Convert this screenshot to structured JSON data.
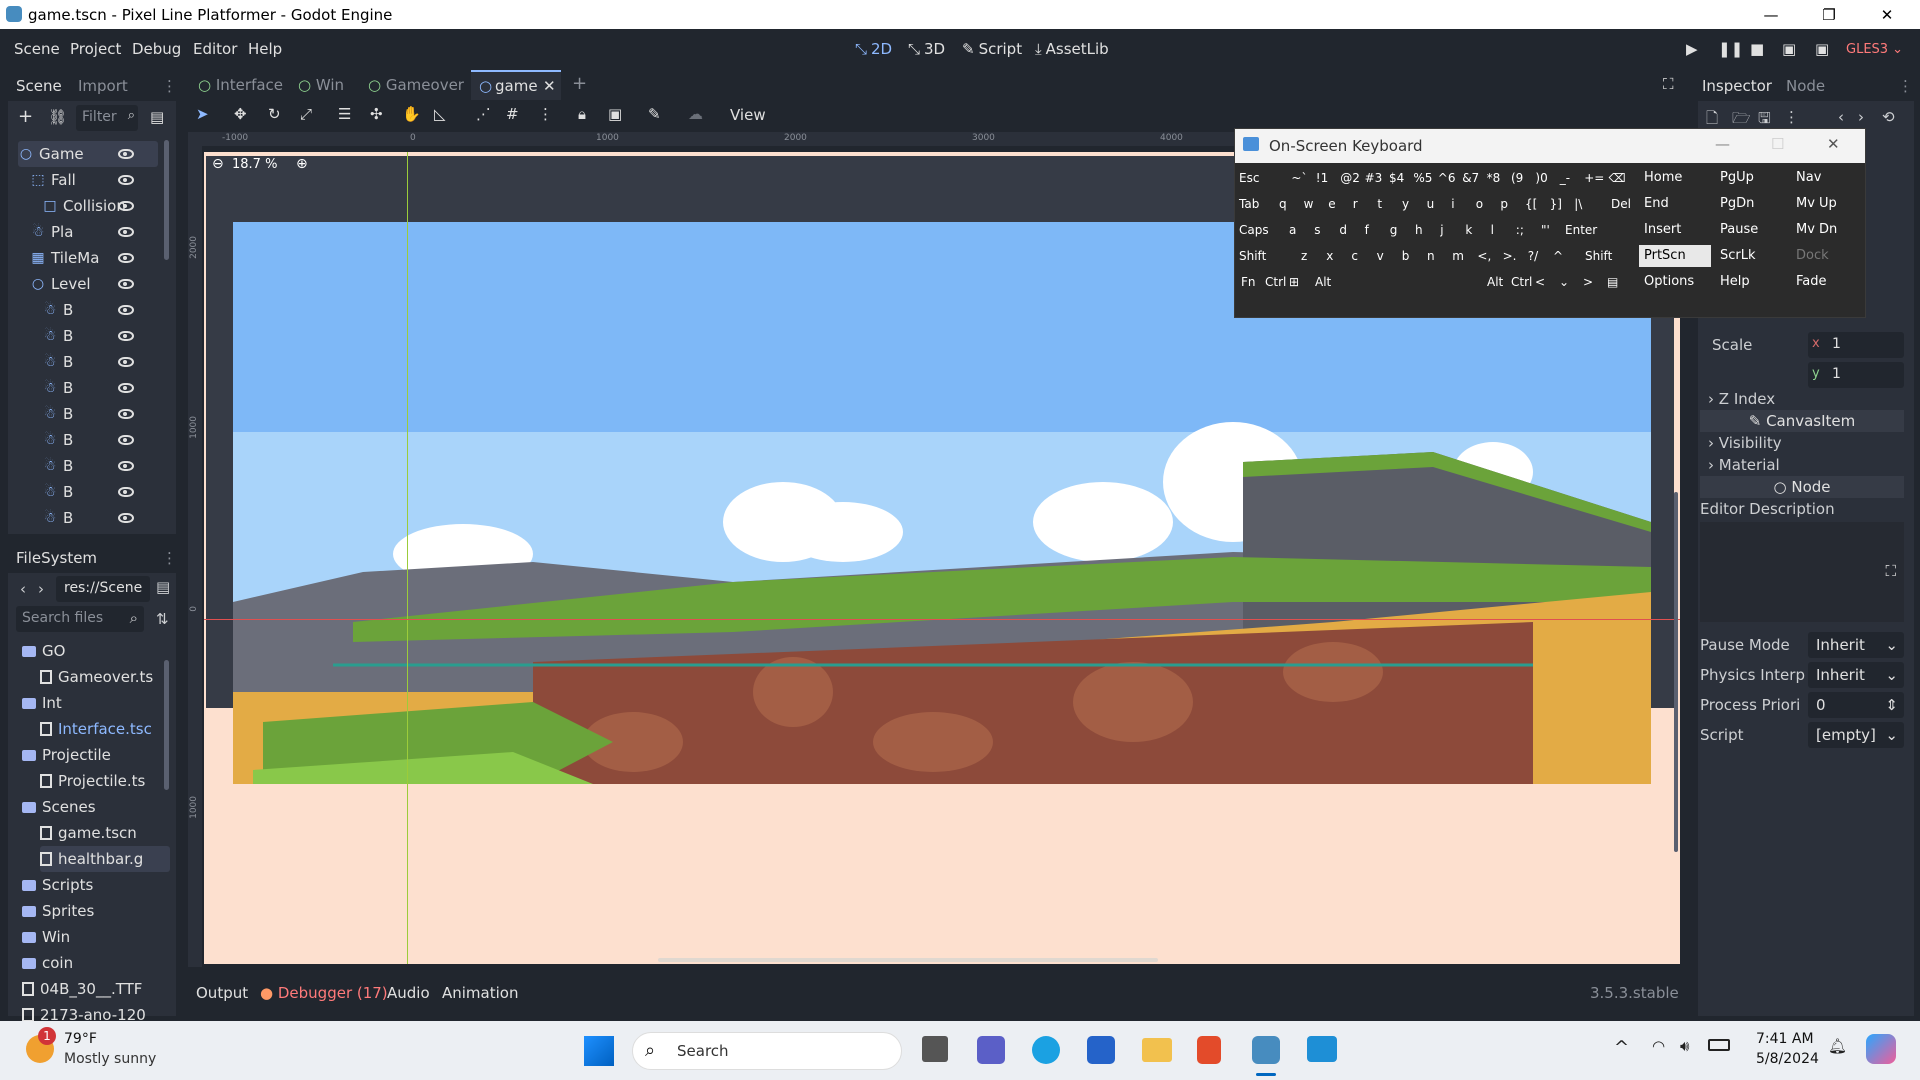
{
  "window": {
    "title": "game.tscn - Pixel Line Platformer - Godot Engine",
    "minimize": "—",
    "maximize": "❐",
    "close": "✕"
  },
  "menu": [
    "Scene",
    "Project",
    "Debug",
    "Editor",
    "Help"
  ],
  "workspaces": {
    "twod": "2D",
    "threed": "3D",
    "script": "Script",
    "assetlib": "AssetLib"
  },
  "renderer": "GLES3 ⌄",
  "scene_dock": {
    "tab_scene": "Scene",
    "tab_import": "Import",
    "filter_placeholder": "Filter",
    "nodes": [
      {
        "label": "Game",
        "icon": "○"
      },
      {
        "label": "Fall",
        "icon": "⬚"
      },
      {
        "label": "Collision",
        "icon": "□"
      },
      {
        "label": "Pla",
        "icon": "☃"
      },
      {
        "label": "TileMa",
        "icon": "▦"
      },
      {
        "label": "Level",
        "icon": "○"
      },
      {
        "label": "B",
        "icon": "☃"
      },
      {
        "label": "B",
        "icon": "☃"
      },
      {
        "label": "B",
        "icon": "☃"
      },
      {
        "label": "B",
        "icon": "☃"
      },
      {
        "label": "B",
        "icon": "☃"
      },
      {
        "label": "B",
        "icon": "☃"
      },
      {
        "label": "B",
        "icon": "☃"
      },
      {
        "label": "B",
        "icon": "☃"
      },
      {
        "label": "B",
        "icon": "☃"
      }
    ]
  },
  "filesystem": {
    "title": "FileSystem",
    "path": "res://Scene",
    "search_placeholder": "Search files",
    "items": [
      {
        "label": "GO",
        "type": "folder"
      },
      {
        "label": "Gameover.ts",
        "type": "file"
      },
      {
        "label": "Int",
        "type": "folder"
      },
      {
        "label": "Interface.tsc",
        "type": "file"
      },
      {
        "label": "Projectile",
        "type": "folder"
      },
      {
        "label": "Projectile.ts",
        "type": "file"
      },
      {
        "label": "Scenes",
        "type": "folder"
      },
      {
        "label": "game.tscn",
        "type": "file"
      },
      {
        "label": "healthbar.g",
        "type": "file"
      },
      {
        "label": "Scripts",
        "type": "folder"
      },
      {
        "label": "Sprites",
        "type": "folder"
      },
      {
        "label": "Win",
        "type": "folder"
      },
      {
        "label": "coin",
        "type": "folder"
      },
      {
        "label": "04B_30__.TTF",
        "type": "file"
      },
      {
        "label": "2173-ano-120",
        "type": "file"
      }
    ]
  },
  "scene_tabs": [
    "Interface",
    "Win",
    "Gameover",
    "game"
  ],
  "viewport": {
    "zoom": "18.7 %",
    "view_label": "View",
    "ruler_top": [
      "-1000",
      "0",
      "1000",
      "2000",
      "3000",
      "4000"
    ],
    "ruler_left": [
      "2000",
      "1000",
      "0",
      "1000"
    ]
  },
  "bottom": {
    "output": "Output",
    "debugger": "Debugger (17)",
    "audio": "Audio",
    "animation": "Animation",
    "version": "3.5.3.stable"
  },
  "keyboard": {
    "title": "On-Screen Keyboard",
    "row1": [
      "Esc",
      "~`",
      "!1",
      "@2",
      "#3",
      "$4",
      "%5",
      "^6",
      "&7",
      "*8",
      "(9",
      ")0",
      "_-",
      "+=",
      "⌫"
    ],
    "row2": [
      "Tab",
      "q",
      "w",
      "e",
      "r",
      "t",
      "y",
      "u",
      "i",
      "o",
      "p",
      "{[",
      "}]",
      "|\\",
      "Del"
    ],
    "row3": [
      "Caps",
      "a",
      "s",
      "d",
      "f",
      "g",
      "h",
      "j",
      "k",
      "l",
      ":;",
      "\"'",
      "Enter"
    ],
    "row4": [
      "Shift",
      "z",
      "x",
      "c",
      "v",
      "b",
      "n",
      "m",
      "<,",
      ">.",
      "?/",
      "^",
      "Shift"
    ],
    "row5": [
      "Fn",
      "Ctrl",
      "⊞",
      "Alt",
      "Alt",
      "Ctrl",
      "<",
      "⌄",
      ">",
      "▤"
    ],
    "nav": [
      [
        "Home",
        "PgUp",
        "Nav"
      ],
      [
        "End",
        "PgDn",
        "Mv Up"
      ],
      [
        "Insert",
        "Pause",
        "Mv Dn"
      ],
      [
        "PrtScn",
        "ScrLk",
        "Dock"
      ],
      [
        "Options",
        "Help",
        "Fade"
      ]
    ]
  },
  "inspector": {
    "tab_inspector": "Inspector",
    "tab_node": "Node",
    "scale_label": "Scale",
    "scale_x_label": "x",
    "scale_x": "1",
    "scale_y_label": "y",
    "scale_y": "1",
    "z_index": "Z Index",
    "canvas_item": "CanvasItem",
    "visibility": "Visibility",
    "material": "Material",
    "node": "Node",
    "editor_description": "Editor Description",
    "pause_mode_label": "Pause Mode",
    "pause_mode": "Inherit",
    "physics_interp_label": "Physics Interp",
    "physics_interp": "Inherit",
    "process_priority_label": "Process Priori",
    "process_priority": "0",
    "script_label": "Script",
    "script": "[empty]"
  },
  "taskbar": {
    "temp": "79°F",
    "weather": "Mostly sunny",
    "badge": "1",
    "search": "Search",
    "time": "7:41 AM",
    "date": "5/8/2024"
  }
}
